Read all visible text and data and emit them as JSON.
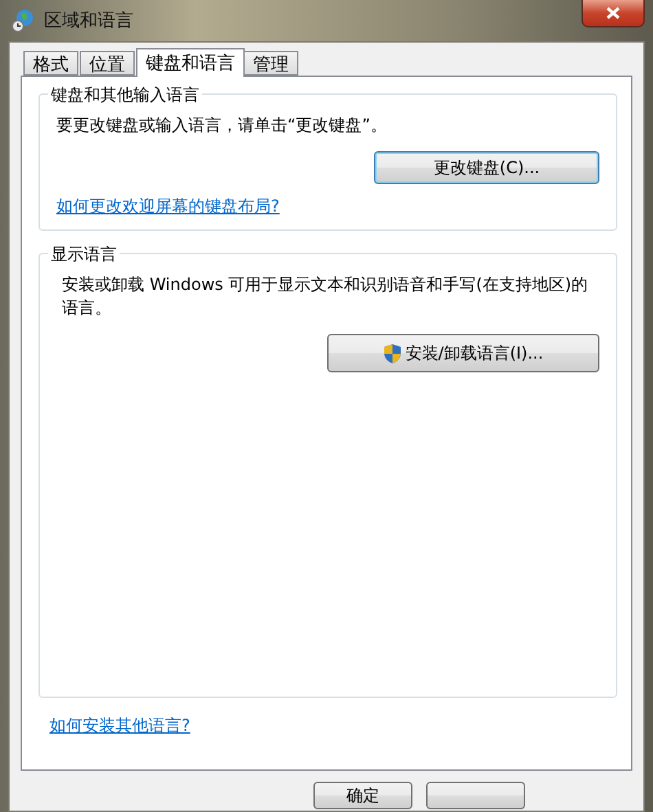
{
  "window": {
    "title": "区域和语言"
  },
  "tabs": [
    {
      "label": "格式",
      "selected": false
    },
    {
      "label": "位置",
      "selected": false
    },
    {
      "label": "键盘和语言",
      "selected": true
    },
    {
      "label": "管理",
      "selected": false
    }
  ],
  "keyboard_group": {
    "title": "键盘和其他输入语言",
    "text": "要更改键盘或输入语言，请单击“更改键盘”。",
    "button": "更改键盘(C)...",
    "link": "如何更改欢迎屏幕的键盘布局?"
  },
  "display_group": {
    "title": "显示语言",
    "text": "安装或卸载 Windows 可用于显示文本和识别语音和手写(在支持地区)的语言。",
    "button": "安装/卸载语言(I)..."
  },
  "bottom_link": "如何安装其他语言?",
  "buttons": [
    {
      "label": "确定"
    }
  ]
}
